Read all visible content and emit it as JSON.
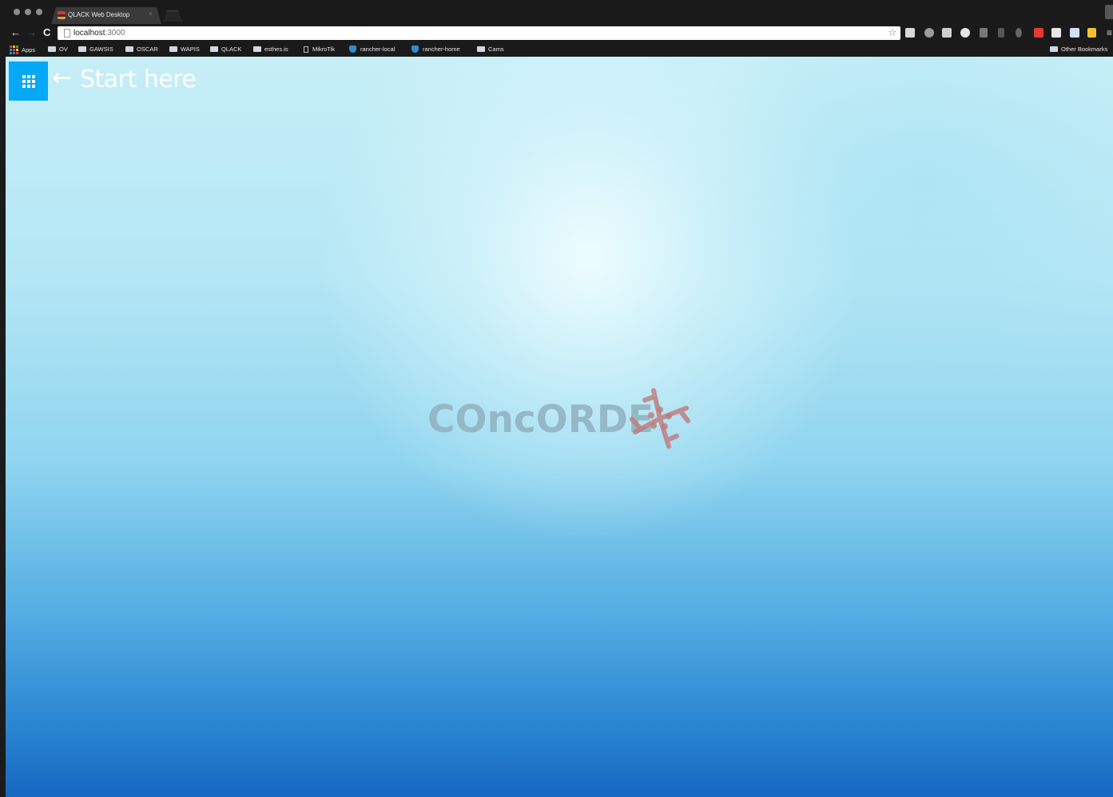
{
  "browser": {
    "tab_title": "QLACK Web Desktop",
    "tab_close": "×",
    "url_host": "localhost",
    "url_port": ":3000"
  },
  "bookmarks": [
    {
      "label": "Apps",
      "icon": "apps-icon"
    },
    {
      "label": "OV",
      "icon": "folder-icon"
    },
    {
      "label": "GAWSIS",
      "icon": "folder-icon"
    },
    {
      "label": "OSCAR",
      "icon": "folder-icon"
    },
    {
      "label": "WAPIS",
      "icon": "folder-icon"
    },
    {
      "label": "QLACK",
      "icon": "folder-icon"
    },
    {
      "label": "esthes.is",
      "icon": "folder-icon"
    },
    {
      "label": "MikroTik",
      "icon": "page-icon"
    },
    {
      "label": "rancher-local",
      "icon": "rancher-icon"
    },
    {
      "label": "rancher-home",
      "icon": "rancher-icon"
    },
    {
      "label": "Cams",
      "icon": "folder-icon"
    }
  ],
  "other_bookmarks": "Other Bookmarks",
  "page": {
    "start_arrow": "←",
    "start_label": "Start here",
    "logo_text": "COncORDE"
  },
  "colors": {
    "launcher": "#03a9f4",
    "logo_text": "#8fb1bf",
    "logo_mark": "#c07a7a"
  }
}
